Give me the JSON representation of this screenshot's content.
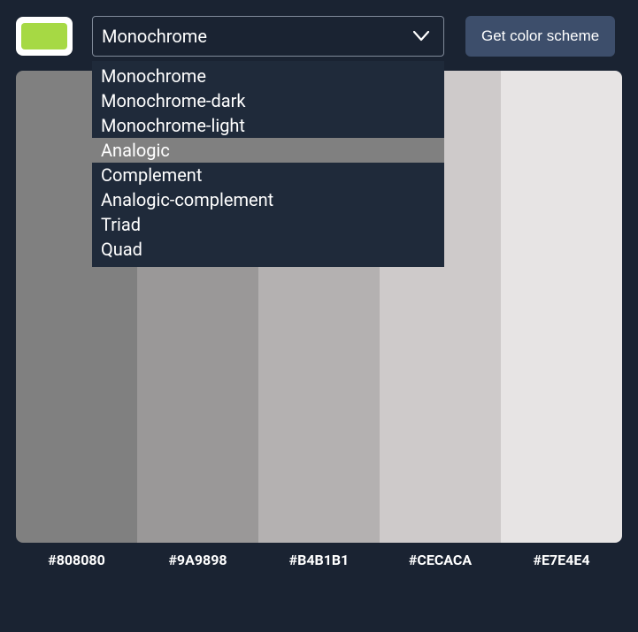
{
  "toolbar": {
    "swatch_color": "#a6d944",
    "select_value": "Monochrome",
    "dropdown_options": [
      {
        "label": "Monochrome",
        "highlighted": false
      },
      {
        "label": "Monochrome-dark",
        "highlighted": false
      },
      {
        "label": "Monochrome-light",
        "highlighted": false
      },
      {
        "label": "Analogic",
        "highlighted": true
      },
      {
        "label": "Complement",
        "highlighted": false
      },
      {
        "label": "Analogic-complement",
        "highlighted": false
      },
      {
        "label": "Triad",
        "highlighted": false
      },
      {
        "label": "Quad",
        "highlighted": false
      }
    ],
    "button_label": "Get color scheme"
  },
  "palette": {
    "colors": [
      {
        "hex": "#808080"
      },
      {
        "hex": "#9A9898"
      },
      {
        "hex": "#B4B1B1"
      },
      {
        "hex": "#CECACA"
      },
      {
        "hex": "#E7E4E4"
      }
    ]
  }
}
